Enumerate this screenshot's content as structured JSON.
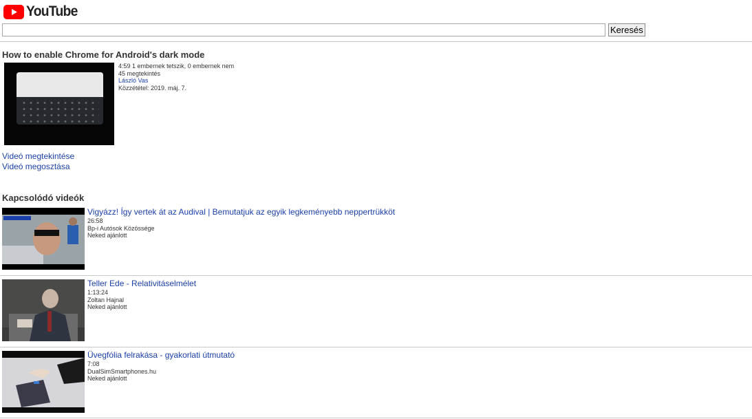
{
  "header": {
    "logo_text": "YouTube",
    "search_placeholder": "",
    "search_button": "Keresés"
  },
  "video": {
    "title": "How to enable Chrome for Android's dark mode",
    "duration": "4:59",
    "likes": "1 embernek tetszik, 0 embernek nem",
    "views": "45 megtekintés",
    "channel": "László Vas",
    "published": "Közzététel: 2019. máj. 7.",
    "watch_link": "Videó megtekintése",
    "share_link": "Videó megosztása"
  },
  "related": {
    "heading": "Kapcsolódó videók",
    "items": [
      {
        "title": "Vigyázz! Így vertek át az Audival | Bemutatjuk az egyik legkeményebb neppertrükköt",
        "duration": "26:58",
        "channel": "Bp-i Autósok Közössége",
        "tag": "Neked ajánlott"
      },
      {
        "title": "Teller Ede - Relativitáselmélet",
        "duration": "1:13:24",
        "channel": "Zoltan Hajnal",
        "tag": "Neked ajánlott"
      },
      {
        "title": "Üvegfólia felrakása - gyakorlati útmutató",
        "duration": "7:08",
        "channel": "DualSimSmartphones.hu",
        "tag": "Neked ajánlott"
      }
    ]
  },
  "colors": {
    "link": "#1a3fa8",
    "logo_red": "#ff0000"
  }
}
